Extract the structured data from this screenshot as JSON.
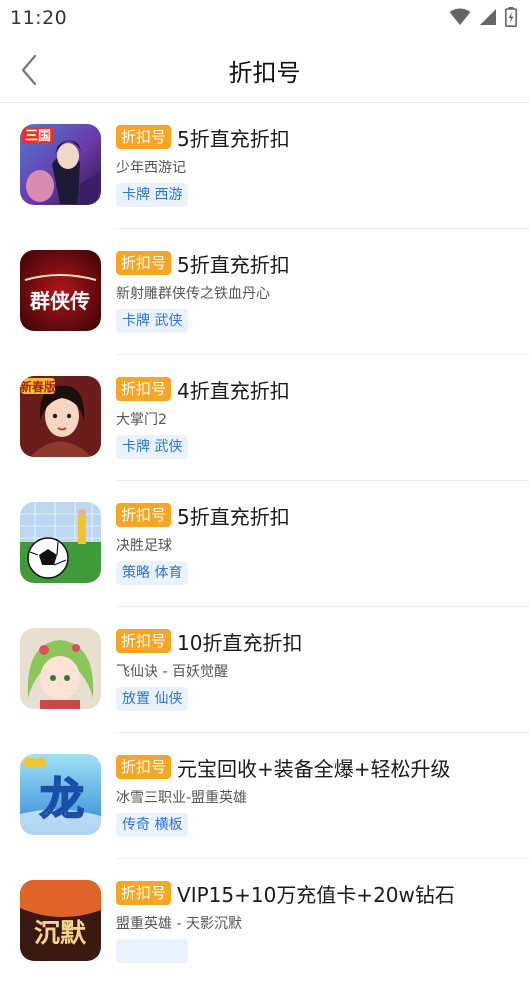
{
  "status_bar": {
    "time": "11:20"
  },
  "header": {
    "title": "折扣号"
  },
  "games": [
    {
      "badge": "折扣号",
      "headline": "5折直充折扣",
      "name": "少年西游记",
      "tags": "卡牌 西游",
      "icon_overlay": "三国"
    },
    {
      "badge": "折扣号",
      "headline": "5折直充折扣",
      "name": "新射雕群侠传之铁血丹心",
      "tags": "卡牌 武侠",
      "icon_overlay": "群侠传"
    },
    {
      "badge": "折扣号",
      "headline": "4折直充折扣",
      "name": "大掌门2",
      "tags": "卡牌 武侠",
      "icon_overlay": "新春版"
    },
    {
      "badge": "折扣号",
      "headline": "5折直充折扣",
      "name": "决胜足球",
      "tags": "策略 体育",
      "icon_overlay": ""
    },
    {
      "badge": "折扣号",
      "headline": "10折直充折扣",
      "name": "飞仙诀 - 百妖觉醒",
      "tags": "放置 仙侠",
      "icon_overlay": ""
    },
    {
      "badge": "折扣号",
      "headline": "元宝回收+装备全爆+轻松升级",
      "name": "冰雪三职业-盟重英雄",
      "tags": "传奇 横板",
      "icon_overlay": "龙"
    },
    {
      "badge": "折扣号",
      "headline": "VIP15+10万充值卡+20w钻石",
      "name": "盟重英雄 - 天影沉默",
      "tags": "",
      "icon_overlay": "沉默"
    }
  ],
  "colors": {
    "badge": "#f6a623",
    "tag_text": "#2e74d6",
    "tag_bg": "#eaf2fd"
  }
}
